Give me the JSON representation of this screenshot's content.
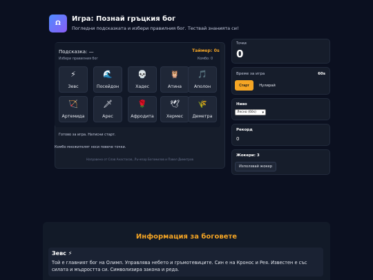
{
  "header": {
    "logo": "Ω",
    "title": "Игра: Познай гръцкия бог",
    "subtitle": "Погледни подсказката и избери правилния бог. Тествай знанията си!"
  },
  "game": {
    "hint_title": "Подсказка: —",
    "hint_sub": "Избери правилния бог",
    "timer": "Таймер: 0s",
    "combo": "Комбо: 0",
    "gods": [
      {
        "icon": "⚡",
        "name": "Зевс",
        "icon_name": "lightning-icon"
      },
      {
        "icon": "🌊",
        "name": "Посейдон",
        "icon_name": "wave-icon"
      },
      {
        "icon": "💀",
        "name": "Хадес",
        "icon_name": "skull-icon"
      },
      {
        "icon": "🦉",
        "name": "Атина",
        "icon_name": "owl-icon"
      },
      {
        "icon": "🎵",
        "name": "Аполон",
        "icon_name": "music-note-icon"
      },
      {
        "icon": "🏹",
        "name": "Артемида",
        "icon_name": "bow-icon"
      },
      {
        "icon": "🗡",
        "name": "Арес",
        "icon_name": "dagger-icon"
      },
      {
        "icon": "🌹",
        "name": "Афродита",
        "icon_name": "rose-icon"
      },
      {
        "icon": "🕊",
        "name": "Хермес",
        "icon_name": "dove-icon"
      },
      {
        "icon": "🌾",
        "name": "Деметра",
        "icon_name": "wheat-icon"
      }
    ],
    "status": "Готово за игра. Натисни старт.",
    "combo_note": "Комбо множителят носи повече точки.",
    "credits": "Направено от Слав Анастасов, Лъчезар Богомилов и Павел Димитров"
  },
  "side": {
    "points_label": "Точки",
    "points_value": "0",
    "time_label": "Време за игра",
    "time_value": "60s",
    "start_label": "Старт",
    "reset_label": "Нулирай",
    "level_label": "Ниво",
    "level_selected": "Лесно (60s)",
    "record_label": "Рекорд",
    "record_value": "0",
    "jokers_label": "Жокери: 3",
    "joker_button": "Използвай жокер"
  },
  "info": {
    "title": "Информация за боговете",
    "god_heading": "Зевс ⚡",
    "god_text": "Той е главният бог на Олимп. Управлява небето и гръмотевиците. Син е на Кронос и Рея. Известен е със силата и мъдростта си. Символизира закона и реда."
  },
  "colors": {
    "accent": "#f5a524",
    "background": "#0b1020",
    "panel": "#161d2b"
  }
}
